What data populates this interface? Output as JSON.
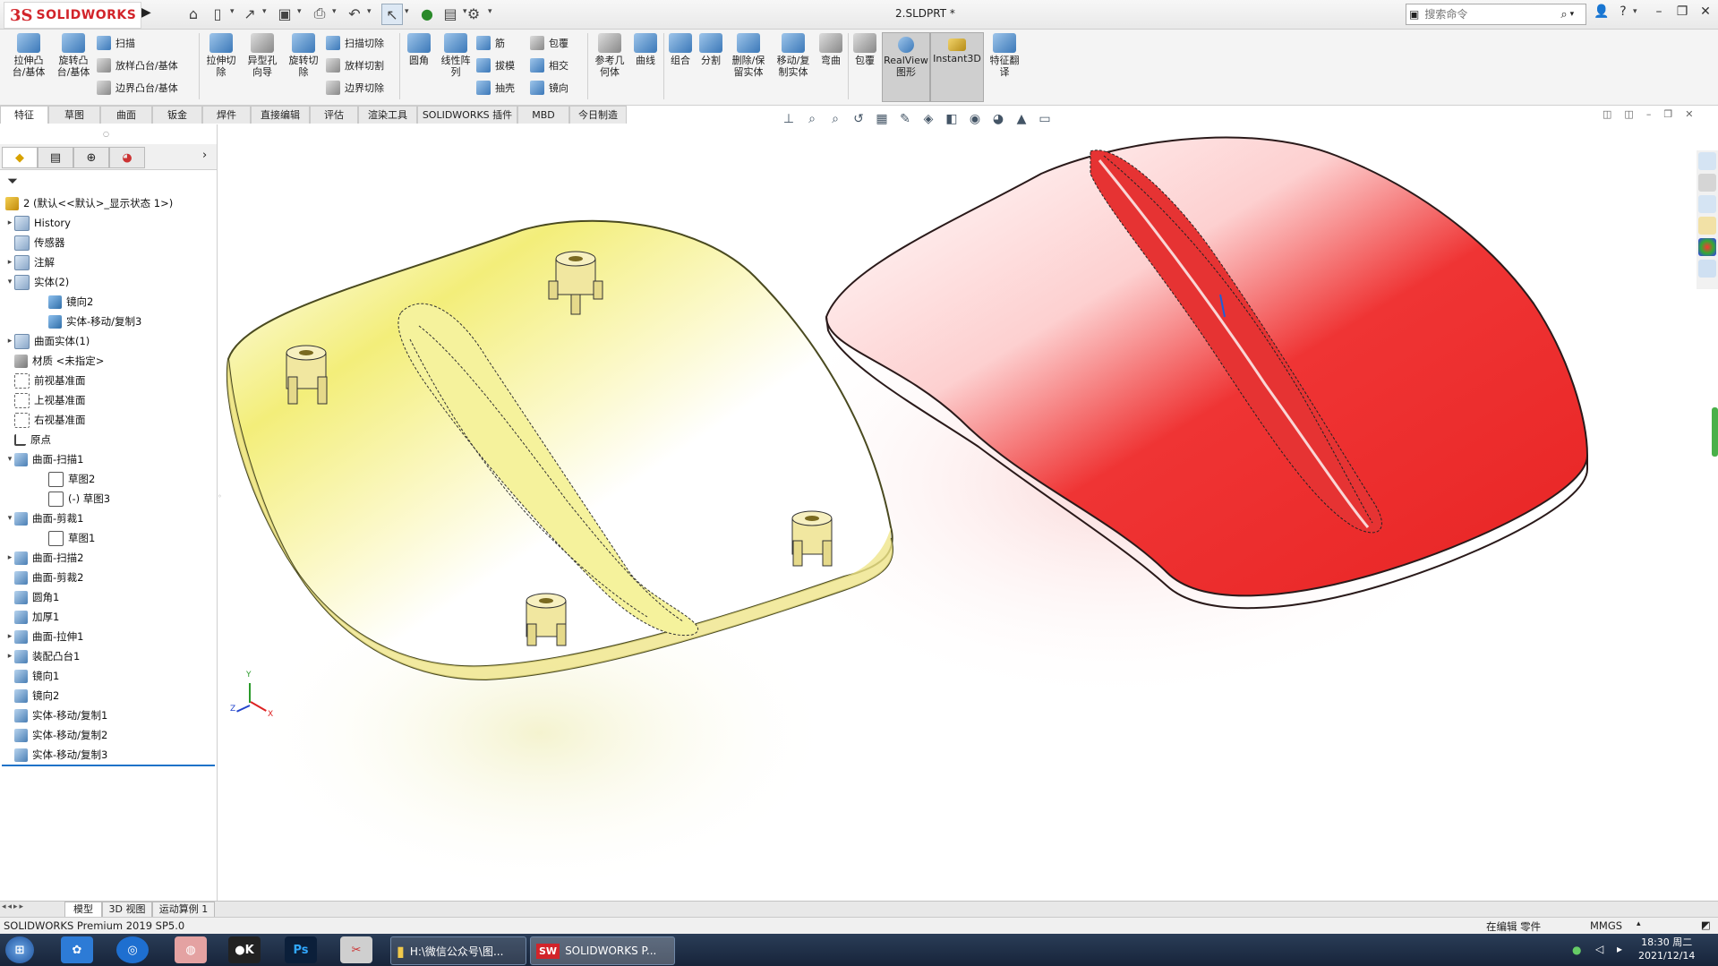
{
  "app": {
    "logo_text": "SOLIDWORKS",
    "document_title": "2.SLDPRT *",
    "search_placeholder": "搜索命令"
  },
  "quick_access": [
    "home-icon",
    "new-icon",
    "open-icon",
    "save-icon",
    "print-icon",
    "undo-icon",
    "select-icon",
    "rebuild-icon",
    "file-properties-icon",
    "options-icon"
  ],
  "command_manager": {
    "big": [
      {
        "name": "extruded-boss-base",
        "label": "拉伸凸\n台/基体"
      },
      {
        "name": "revolved-boss-base",
        "label": "旋转凸\n台/基体"
      },
      {
        "name": "extruded-cut",
        "label": "拉伸切\n除"
      },
      {
        "name": "hole-wizard",
        "label": "异型孔\n向导"
      },
      {
        "name": "revolved-cut",
        "label": "旋转切\n除"
      },
      {
        "name": "fillet",
        "label": "圆角"
      },
      {
        "name": "linear-pattern",
        "label": "线性阵\n列"
      },
      {
        "name": "reference-geometry",
        "label": "参考几\n何体"
      },
      {
        "name": "curves",
        "label": "曲线"
      },
      {
        "name": "combine",
        "label": "组合"
      },
      {
        "name": "split",
        "label": "分割"
      },
      {
        "name": "delete-keep-body",
        "label": "删除/保\n留实体"
      },
      {
        "name": "move-copy-body",
        "label": "移动/复\n制实体"
      },
      {
        "name": "flex",
        "label": "弯曲"
      },
      {
        "name": "wrap2",
        "label": "包覆"
      },
      {
        "name": "realview",
        "label": "RealView\n图形"
      },
      {
        "name": "instant3d",
        "label": "Instant3D"
      },
      {
        "name": "feature-works",
        "label": "特征翻\n译"
      }
    ],
    "small": [
      {
        "name": "swept-boss",
        "label": "扫描"
      },
      {
        "name": "lofted-boss",
        "label": "放样凸台/基体"
      },
      {
        "name": "boundary-boss",
        "label": "边界凸台/基体"
      },
      {
        "name": "swept-cut",
        "label": "扫描切除"
      },
      {
        "name": "lofted-cut",
        "label": "放样切割"
      },
      {
        "name": "boundary-cut",
        "label": "边界切除"
      },
      {
        "name": "rib",
        "label": "筋"
      },
      {
        "name": "draft",
        "label": "拔模"
      },
      {
        "name": "shell",
        "label": "抽壳"
      },
      {
        "name": "wrap",
        "label": "包覆"
      },
      {
        "name": "intersect",
        "label": "相交"
      },
      {
        "name": "mirror",
        "label": "镜向"
      }
    ]
  },
  "tabs": [
    "特征",
    "草图",
    "曲面",
    "钣金",
    "焊件",
    "直接编辑",
    "评估",
    "渲染工具",
    "SOLIDWORKS 插件",
    "MBD",
    "今日制造"
  ],
  "feature_tree": {
    "root": "2 (默认<<默认>_显示状态 1>)",
    "items": [
      {
        "label": "History",
        "level": 1,
        "expand": "▸",
        "icon": "folder"
      },
      {
        "label": "传感器",
        "level": 1,
        "expand": "",
        "icon": "folder"
      },
      {
        "label": "注解",
        "level": 1,
        "expand": "▸",
        "icon": "folder"
      },
      {
        "label": "实体(2)",
        "level": 1,
        "expand": "▾",
        "icon": "folder"
      },
      {
        "label": "镜向2",
        "level": 2,
        "expand": "",
        "icon": "body"
      },
      {
        "label": "实体-移动/复制3",
        "level": 2,
        "expand": "",
        "icon": "body"
      },
      {
        "label": "曲面实体(1)",
        "level": 1,
        "expand": "▸",
        "icon": "folder"
      },
      {
        "label": "材质 <未指定>",
        "level": 1,
        "expand": "",
        "icon": "mat"
      },
      {
        "label": "前视基准面",
        "level": 1,
        "expand": "",
        "icon": "plane"
      },
      {
        "label": "上视基准面",
        "level": 1,
        "expand": "",
        "icon": "plane"
      },
      {
        "label": "右视基准面",
        "level": 1,
        "expand": "",
        "icon": "plane"
      },
      {
        "label": "原点",
        "level": 1,
        "expand": "",
        "icon": "origin"
      },
      {
        "label": "曲面-扫描1",
        "level": 1,
        "expand": "▾",
        "icon": "feat"
      },
      {
        "label": "草图2",
        "level": 2,
        "expand": "",
        "icon": "sketch"
      },
      {
        "label": "(-) 草图3",
        "level": 2,
        "expand": "",
        "icon": "sketch"
      },
      {
        "label": "曲面-剪裁1",
        "level": 1,
        "expand": "▾",
        "icon": "feat"
      },
      {
        "label": "草图1",
        "level": 2,
        "expand": "",
        "icon": "sketch"
      },
      {
        "label": "曲面-扫描2",
        "level": 1,
        "expand": "▸",
        "icon": "feat"
      },
      {
        "label": "曲面-剪裁2",
        "level": 1,
        "expand": "",
        "icon": "feat"
      },
      {
        "label": "圆角1",
        "level": 1,
        "expand": "",
        "icon": "feat"
      },
      {
        "label": "加厚1",
        "level": 1,
        "expand": "",
        "icon": "feat"
      },
      {
        "label": "曲面-拉伸1",
        "level": 1,
        "expand": "▸",
        "icon": "feat"
      },
      {
        "label": "装配凸台1",
        "level": 1,
        "expand": "▸",
        "icon": "feat"
      },
      {
        "label": "镜向1",
        "level": 1,
        "expand": "",
        "icon": "feat"
      },
      {
        "label": "镜向2",
        "level": 1,
        "expand": "",
        "icon": "feat"
      },
      {
        "label": "实体-移动/复制1",
        "level": 1,
        "expand": "",
        "icon": "feat"
      },
      {
        "label": "实体-移动/复制2",
        "level": 1,
        "expand": "",
        "icon": "feat"
      },
      {
        "label": "实体-移动/复制3",
        "level": 1,
        "expand": "",
        "icon": "feat"
      }
    ]
  },
  "triad": {
    "x": "X",
    "y": "Y",
    "z": "Z"
  },
  "bottom_tabs": [
    "模型",
    "3D 视图",
    "运动算例 1"
  ],
  "status": {
    "version": "SOLIDWORKS Premium 2019 SP5.0",
    "mode": "在编辑 零件",
    "units": "MMGS"
  },
  "taskbar": {
    "folder_task": "H:\\微信公众号\\图...",
    "sw_task": "SOLIDWORKS P...",
    "time": "18:30 周二",
    "date": "2021/12/14"
  },
  "colors": {
    "part_left": "#f5f08a",
    "part_right": "#ee2b2b",
    "accent": "#1e72c8"
  }
}
